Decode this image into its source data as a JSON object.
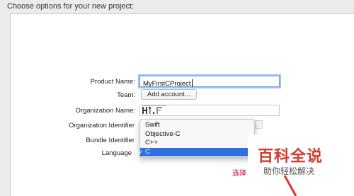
{
  "dialog": {
    "title": "Choose options for your new project:"
  },
  "form": {
    "product_name": {
      "label": "Product Name:",
      "value": "MyFirstCProject"
    },
    "team": {
      "label": "Team:",
      "button": "Add account..."
    },
    "organization_name": {
      "label": "Organization Name:",
      "value": ""
    },
    "organization_identifier": {
      "label": "Organization Identifier"
    },
    "bundle_identifier": {
      "label": "Bundle Identifier"
    },
    "language": {
      "label": "Language",
      "options": [
        "Swift",
        "Objective-C",
        "C++",
        "C"
      ],
      "selected": "C",
      "check": "✓"
    }
  },
  "partial_text": "选择",
  "watermark": {
    "title": "百科全说",
    "subtitle": "助你轻松解决"
  },
  "colors": {
    "accent": "#2f6fde",
    "focus_ring": "#9cc4f0",
    "warning": "#d0021b",
    "watermark": "#d43c2d"
  }
}
